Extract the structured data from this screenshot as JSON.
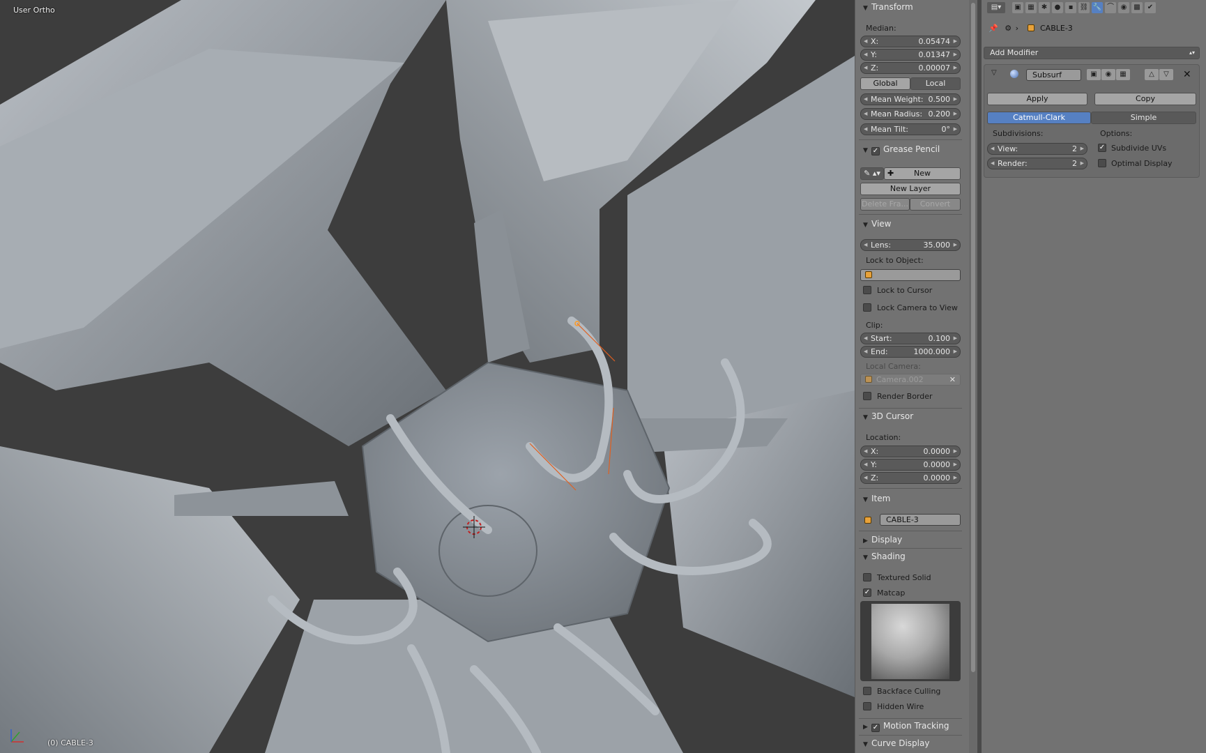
{
  "viewport": {
    "view_name": "User Ortho",
    "object_label": "(0) CABLE-3"
  },
  "npanel": {
    "transform": {
      "title": "Transform",
      "median_label": "Median:",
      "x": {
        "label": "X:",
        "value": "0.05474"
      },
      "y": {
        "label": "Y:",
        "value": "0.01347"
      },
      "z": {
        "label": "Z:",
        "value": "0.00007"
      },
      "global": "Global",
      "local": "Local",
      "mean_weight": {
        "label": "Mean Weight:",
        "value": "0.500"
      },
      "mean_radius": {
        "label": "Mean Radius:",
        "value": "0.200"
      },
      "mean_tilt": {
        "label": "Mean Tilt:",
        "value": "0°"
      }
    },
    "grease_pencil": {
      "title": "Grease Pencil",
      "new": "New",
      "new_layer": "New Layer",
      "delete_frame": "Delete Fra...",
      "convert": "Convert"
    },
    "view": {
      "title": "View",
      "lens": {
        "label": "Lens:",
        "value": "35.000"
      },
      "lock_to_object": "Lock to Object:",
      "lock_to_cursor": "Lock to Cursor",
      "lock_camera": "Lock Camera to View",
      "clip": "Clip:",
      "start": {
        "label": "Start:",
        "value": "0.100"
      },
      "end": {
        "label": "End:",
        "value": "1000.000"
      },
      "local_camera": "Local Camera:",
      "camera_name": "Camera.002",
      "render_border": "Render Border"
    },
    "cursor": {
      "title": "3D Cursor",
      "location": "Location:",
      "x": {
        "label": "X:",
        "value": "0.0000"
      },
      "y": {
        "label": "Y:",
        "value": "0.0000"
      },
      "z": {
        "label": "Z:",
        "value": "0.0000"
      }
    },
    "item": {
      "title": "Item",
      "name": "CABLE-3"
    },
    "display": {
      "title": "Display"
    },
    "shading": {
      "title": "Shading",
      "textured_solid": "Textured Solid",
      "matcap": "Matcap",
      "matcap_checked": true,
      "backface_culling": "Backface Culling",
      "hidden_wire": "Hidden Wire"
    },
    "motion_tracking": {
      "title": "Motion Tracking"
    },
    "curve_display": {
      "title": "Curve Display"
    }
  },
  "properties": {
    "object_name": "CABLE-3",
    "add_modifier": "Add Modifier",
    "modifier": {
      "name": "Subsurf",
      "apply": "Apply",
      "copy": "Copy",
      "catmull": "Catmull-Clark",
      "simple": "Simple",
      "subdivisions": "Subdivisions:",
      "view": {
        "label": "View:",
        "value": "2"
      },
      "render": {
        "label": "Render:",
        "value": "2"
      },
      "options": "Options:",
      "subdivide_uvs": "Subdivide UVs",
      "subdivide_uvs_checked": true,
      "optimal_display": "Optimal Display"
    }
  },
  "colors": {
    "active_blue": "#5680c2",
    "panel_bg": "#727272",
    "viewport_bg": "#3d3d3d",
    "curve_orange": "#e06020"
  }
}
